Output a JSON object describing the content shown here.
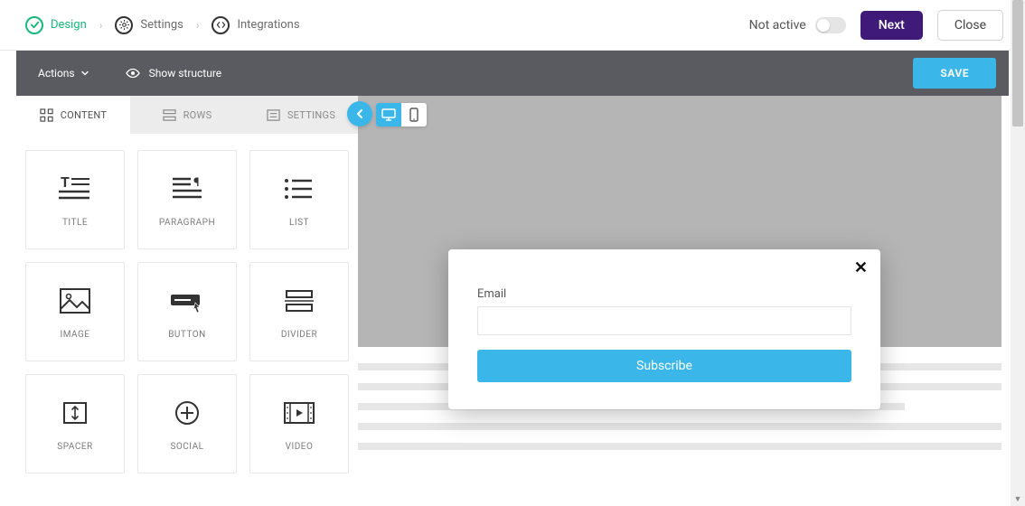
{
  "breadcrumbs": {
    "design": "Design",
    "settings": "Settings",
    "integrations": "Integrations"
  },
  "top": {
    "status": "Not active",
    "next": "Next",
    "close": "Close"
  },
  "actionbar": {
    "actions": "Actions",
    "show_structure": "Show structure",
    "save": "SAVE"
  },
  "sidebar": {
    "tabs": {
      "content": "CONTENT",
      "rows": "ROWS",
      "settings": "SETTINGS"
    },
    "blocks": [
      {
        "label": "TITLE"
      },
      {
        "label": "PARAGRAPH"
      },
      {
        "label": "LIST"
      },
      {
        "label": "IMAGE"
      },
      {
        "label": "BUTTON"
      },
      {
        "label": "DIVIDER"
      },
      {
        "label": "SPACER"
      },
      {
        "label": "SOCIAL"
      },
      {
        "label": "VIDEO"
      }
    ]
  },
  "popup": {
    "email_label": "Email",
    "subscribe": "Subscribe"
  }
}
